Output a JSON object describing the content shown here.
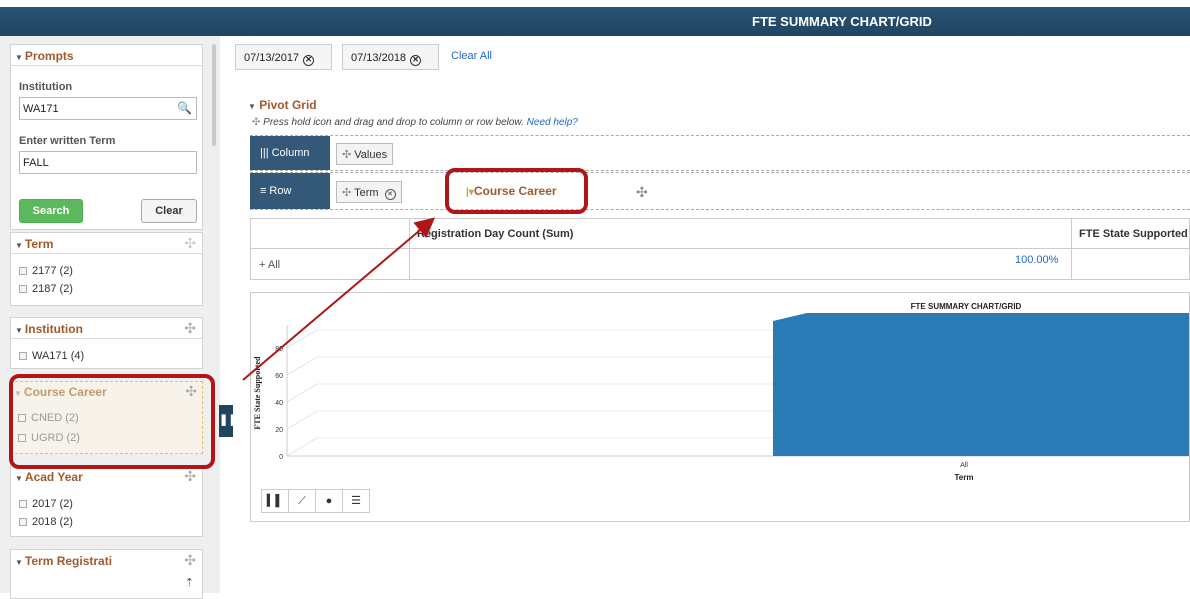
{
  "header": {
    "title": "FTE SUMMARY CHART/GRID"
  },
  "prompts": {
    "title": "Prompts",
    "institution_label": "Institution",
    "institution_value": "WA171",
    "term_label": "Enter written Term",
    "term_value": "FALL",
    "search_label": "Search",
    "clear_label": "Clear"
  },
  "facets": {
    "term": {
      "title": "Term",
      "options": [
        "2177 (2)",
        "2187 (2)"
      ]
    },
    "institution": {
      "title": "Institution",
      "options": [
        "WA171 (4)"
      ]
    },
    "course_career": {
      "title": "Course Career",
      "options": [
        "CNED (2)",
        "UGRD (2)"
      ]
    },
    "acad_year": {
      "title": "Acad Year",
      "options": [
        "2017 (2)",
        "2018 (2)"
      ]
    },
    "term_registration": {
      "title": "Term Registrati"
    }
  },
  "filters": {
    "chips": [
      "07/13/2017",
      "07/13/2018"
    ],
    "clear_all": "Clear All"
  },
  "pivot": {
    "title": "Pivot Grid",
    "hint": "Press hold icon and drag and drop to column or row below.",
    "help_link": "Need help?",
    "column_label": "Column",
    "values_pill": "Values",
    "row_label": "Row",
    "term_pill": "Term",
    "dragging_pill": "Course Career"
  },
  "grid": {
    "headers": [
      "Registration Day Count (Sum)",
      "FTE State Supported ("
    ],
    "row_label": "+ All",
    "row_value": "100.00%"
  },
  "chart_data": {
    "type": "area",
    "title": "FTE SUMMARY CHART/GRID",
    "xlabel": "Term",
    "ylabel": "FTE State Supported",
    "categories": [
      "All"
    ],
    "y_ticks": [
      "0",
      "20",
      "40",
      "60",
      "80"
    ],
    "series": [
      {
        "values": [
          100
        ]
      }
    ],
    "color": "#2a7ab5"
  }
}
